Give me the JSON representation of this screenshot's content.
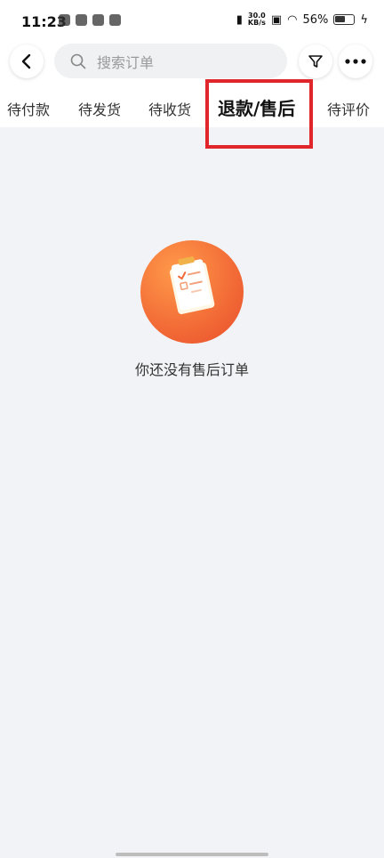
{
  "status_bar": {
    "time": "11:23",
    "speed_value": "30.0",
    "speed_unit": "KB/s",
    "battery": "56%"
  },
  "search": {
    "placeholder": "搜索订单"
  },
  "tabs": [
    {
      "label": "待付款"
    },
    {
      "label": "待发货"
    },
    {
      "label": "待收货"
    },
    {
      "label": "退款/售后"
    },
    {
      "label": "待评价"
    }
  ],
  "empty_state": {
    "message": "你还没有售后订单"
  },
  "colors": {
    "highlight": "#e0262b",
    "illustration": "#f26a36"
  }
}
